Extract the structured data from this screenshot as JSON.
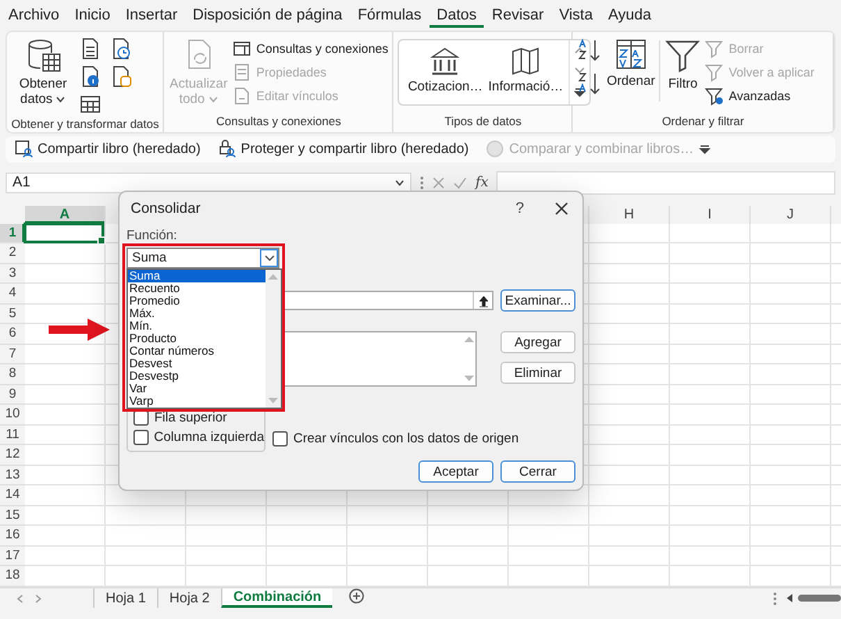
{
  "menu_tabs": [
    {
      "label": "Archivo",
      "selected": false
    },
    {
      "label": "Inicio",
      "selected": false
    },
    {
      "label": "Insertar",
      "selected": false
    },
    {
      "label": "Disposición de página",
      "selected": false
    },
    {
      "label": "Fórmulas",
      "selected": false
    },
    {
      "label": "Datos",
      "selected": true
    },
    {
      "label": "Revisar",
      "selected": false
    },
    {
      "label": "Vista",
      "selected": false
    },
    {
      "label": "Ayuda",
      "selected": false
    }
  ],
  "ribbon": {
    "groups": [
      {
        "title": "Obtener y transformar datos",
        "buttons": [
          {
            "label": "Obtener datos",
            "disabled": false
          }
        ]
      },
      {
        "title": "Consultas y conexiones",
        "buttons": [
          {
            "label": "Actualizar todo",
            "disabled": true
          },
          {
            "label": "Consultas y conexiones",
            "disabled": false
          },
          {
            "label": "Propiedades",
            "disabled": true
          },
          {
            "label": "Editar vínculos",
            "disabled": true
          }
        ]
      },
      {
        "title": "Tipos de datos",
        "buttons": [
          {
            "label": "Cotizacion…",
            "disabled": false
          },
          {
            "label": "Informació…",
            "disabled": false
          }
        ]
      },
      {
        "title": "Ordenar y filtrar",
        "buttons": [
          {
            "label": "Ordenar",
            "disabled": false
          },
          {
            "label": "Filtro",
            "disabled": false
          },
          {
            "label": "Borrar",
            "disabled": true
          },
          {
            "label": "Volver a aplicar",
            "disabled": true
          },
          {
            "label": "Avanzadas",
            "disabled": false
          }
        ]
      }
    ]
  },
  "quick_toolbar": [
    {
      "label": "Compartir libro (heredado)",
      "disabled": false
    },
    {
      "label": "Proteger y compartir libro (heredado)",
      "disabled": false
    },
    {
      "label": "Comparar y combinar libros…",
      "disabled": true
    }
  ],
  "formula_bar": {
    "name_box": "A1",
    "function_symbol": "fx"
  },
  "grid": {
    "columns": [
      {
        "label": "A",
        "selected": true
      },
      {
        "label": "H",
        "selected": false
      },
      {
        "label": "I",
        "selected": false
      },
      {
        "label": "J",
        "selected": false
      }
    ],
    "rows": [
      {
        "label": "1",
        "selected": true
      },
      {
        "label": "2",
        "selected": false
      },
      {
        "label": "3",
        "selected": false
      },
      {
        "label": "4",
        "selected": false
      },
      {
        "label": "5",
        "selected": false
      },
      {
        "label": "6",
        "selected": false
      },
      {
        "label": "7",
        "selected": false
      },
      {
        "label": "8",
        "selected": false
      },
      {
        "label": "9",
        "selected": false
      },
      {
        "label": "10",
        "selected": false
      },
      {
        "label": "11",
        "selected": false
      },
      {
        "label": "12",
        "selected": false
      },
      {
        "label": "13",
        "selected": false
      },
      {
        "label": "14",
        "selected": false
      },
      {
        "label": "15",
        "selected": false
      },
      {
        "label": "16",
        "selected": false
      },
      {
        "label": "17",
        "selected": false
      },
      {
        "label": "18",
        "selected": false
      }
    ]
  },
  "sheet_tabs": [
    {
      "label": "Hoja 1",
      "selected": false
    },
    {
      "label": "Hoja 2",
      "selected": false
    },
    {
      "label": "Combinación",
      "selected": true
    }
  ],
  "dialog": {
    "title": "Consolidar",
    "help": "?",
    "function_label": "Función:",
    "function_value": "Suma",
    "function_options": [
      {
        "label": "Suma",
        "selected": true
      },
      {
        "label": "Recuento",
        "selected": false
      },
      {
        "label": "Promedio",
        "selected": false
      },
      {
        "label": "Máx.",
        "selected": false
      },
      {
        "label": "Mín.",
        "selected": false
      },
      {
        "label": "Producto",
        "selected": false
      },
      {
        "label": "Contar números",
        "selected": false
      },
      {
        "label": "Desvest",
        "selected": false
      },
      {
        "label": "Desvestp",
        "selected": false
      },
      {
        "label": "Var",
        "selected": false
      },
      {
        "label": "Varp",
        "selected": false
      }
    ],
    "browse_button": "Examinar...",
    "add_button": "Agregar",
    "delete_button": "Eliminar",
    "checkboxes": [
      {
        "label": "Fila superior",
        "checked": false
      },
      {
        "label": "Columna izquierda",
        "checked": false
      },
      {
        "label": "Crear vínculos con los datos de origen",
        "checked": false
      }
    ],
    "buttons": [
      "Aceptar",
      "Cerrar"
    ]
  }
}
